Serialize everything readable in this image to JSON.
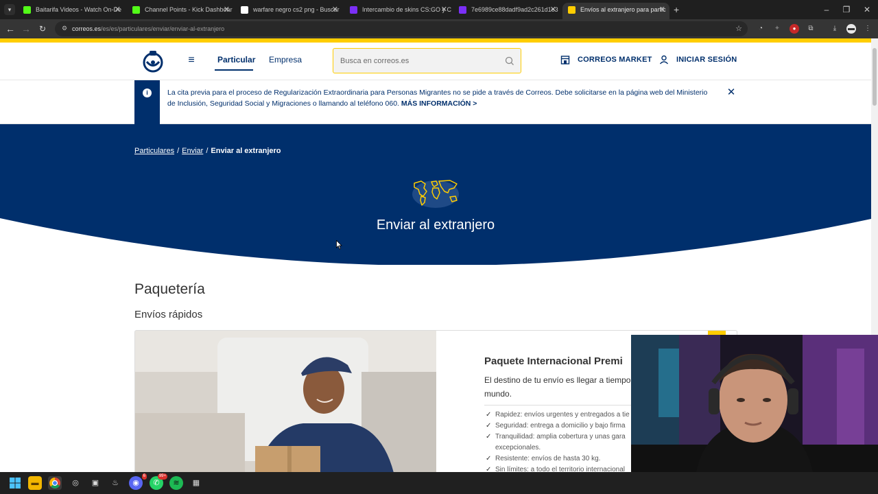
{
  "browser": {
    "tabs": [
      {
        "title": "Baitarifa Videos - Watch On-De",
        "favicon_color": "#53fc18",
        "active": false
      },
      {
        "title": "Channel Points - Kick Dashboar",
        "favicon_color": "#53fc18",
        "active": false
      },
      {
        "title": "warfare negro cs2 png - Buscar",
        "favicon_color": "#ffffff",
        "active": false
      },
      {
        "title": "Intercambio de skins CS:GO y C",
        "favicon_color": "#7b2ff7",
        "active": false
      },
      {
        "title": "7e6989ce88dadf9ad2c261d1e3",
        "favicon_color": "#7b2ff7",
        "active": false
      },
      {
        "title": "Envíos al extranjero para partic",
        "favicon_color": "#ffcd00",
        "active": true
      }
    ],
    "url_domain": "correos.es",
    "url_path": "/es/es/particulares/enviar/enviar-al-extranjero"
  },
  "header": {
    "nav": {
      "particular": "Particular",
      "empresa": "Empresa"
    },
    "search_placeholder": "Busca en correos.es",
    "market": "CORREOS MARKET",
    "login": "INICIAR SESIÓN"
  },
  "alert": {
    "text": "La cita previa para el proceso de Regularización Extraordinaria para Personas Migrantes no se pide a través de Correos. Debe solicitarse en la página web del Ministerio de Inclusión, Seguridad Social y Migraciones o llamando al teléfono 060. ",
    "link": "MÁS INFORMACIÓN >"
  },
  "breadcrumb": {
    "items": [
      "Particulares",
      "Enviar"
    ],
    "current": "Enviar al extranjero"
  },
  "hero": {
    "title": "Enviar al extranjero"
  },
  "content": {
    "section_title": "Paquetería",
    "section_subtitle": "Envíos rápidos",
    "card": {
      "title": "Paquete Internacional Premi",
      "description": "El destino de tu envío es llegar a tiempo, lugar del mundo.",
      "features": [
        "Rapidez: envíos urgentes y entregados a tie",
        "Seguridad: entrega a domicilio y bajo firma",
        "Tranquilidad: amplia cobertura y unas gara",
        "excepcionales.",
        "Resistente: envíos de hasta 30 kg.",
        "Sin límites: a todo el territorio internacional"
      ]
    }
  },
  "taskbar": {
    "badges": {
      "discord": "6",
      "whatsapp": "99+"
    }
  },
  "colors": {
    "brand_blue": "#002f6c",
    "brand_yellow": "#ffcd00"
  }
}
